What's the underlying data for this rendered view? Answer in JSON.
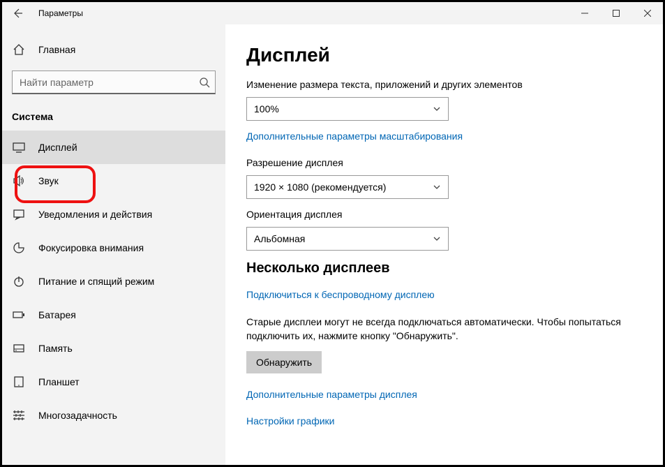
{
  "window": {
    "title": "Параметры"
  },
  "sidebar": {
    "home": "Главная",
    "search_placeholder": "Найти параметр",
    "category": "Система",
    "items": [
      {
        "key": "display",
        "label": "Дисплей"
      },
      {
        "key": "sound",
        "label": "Звук"
      },
      {
        "key": "notifications",
        "label": "Уведомления и действия"
      },
      {
        "key": "focus",
        "label": "Фокусировка внимания"
      },
      {
        "key": "power",
        "label": "Питание и спящий режим"
      },
      {
        "key": "battery",
        "label": "Батарея"
      },
      {
        "key": "storage",
        "label": "Память"
      },
      {
        "key": "tablet",
        "label": "Планшет"
      },
      {
        "key": "multitask",
        "label": "Многозадачность"
      }
    ]
  },
  "main": {
    "title": "Дисплей",
    "scale_label": "Изменение размера текста, приложений и других элементов",
    "scale_value": "100%",
    "adv_scale_link": "Дополнительные параметры масштабирования",
    "resolution_label": "Разрешение дисплея",
    "resolution_value": "1920 × 1080 (рекомендуется)",
    "orientation_label": "Ориентация дисплея",
    "orientation_value": "Альбомная",
    "multi_title": "Несколько дисплеев",
    "wireless_link": "Подключиться к беспроводному дисплею",
    "detect_info": "Старые дисплеи могут не всегда подключаться автоматически. Чтобы попытаться подключить их, нажмите кнопку \"Обнаружить\".",
    "detect_btn": "Обнаружить",
    "adv_display_link": "Дополнительные параметры дисплея",
    "graphics_link": "Настройки графики"
  }
}
